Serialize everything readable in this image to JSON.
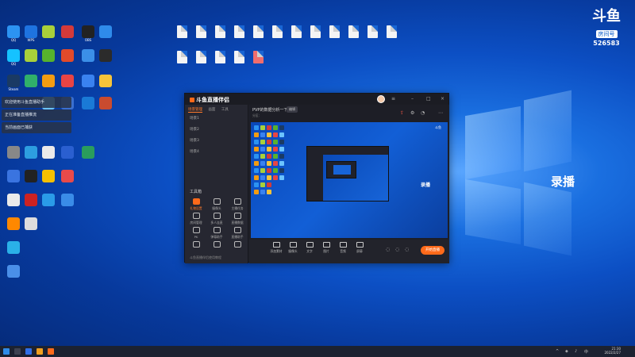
{
  "desktop_icons_left": [
    {
      "label": "QQ",
      "color": "#2c93f2"
    },
    {
      "label": "WPS",
      "color": "#1e73e0"
    },
    {
      "label": "",
      "color": "#a8d03a"
    },
    {
      "label": "",
      "color": "#d43a3a"
    },
    {
      "label": "OBS",
      "color": "#222222"
    },
    {
      "label": "",
      "color": "#2f8bea"
    },
    {
      "label": "QQ",
      "color": "#15c2ff"
    },
    {
      "label": "",
      "color": "#a8d03a"
    },
    {
      "label": "",
      "color": "#57b22d"
    },
    {
      "label": "",
      "color": "#e24a2a"
    },
    {
      "label": "",
      "color": "#3b8fe8"
    },
    {
      "label": "",
      "color": "#2b2b2b"
    },
    {
      "label": "Steam",
      "color": "#1a3a64"
    },
    {
      "label": "",
      "color": "#30b06a"
    },
    {
      "label": "",
      "color": "#f39c12"
    },
    {
      "label": "",
      "color": "#e94444"
    },
    {
      "label": "",
      "color": "#3a82f0"
    },
    {
      "label": "",
      "color": "#f6c43a"
    },
    {
      "label": "",
      "color": "#6cc3ff"
    },
    {
      "label": "",
      "color": "#3a6fd0"
    },
    {
      "label": "",
      "color": "#1a7ad6"
    },
    {
      "label": "",
      "color": "#c94b2f"
    },
    {
      "label": "",
      "color": "#888888"
    },
    {
      "label": "",
      "color": "#2d9ee0"
    },
    {
      "label": "",
      "color": "#eaeaea"
    },
    {
      "label": "",
      "color": "#2a5fd0"
    },
    {
      "label": "",
      "color": "#2a9d5c"
    },
    {
      "label": "",
      "color": "#3a74e0"
    },
    {
      "label": "",
      "color": "#222222"
    },
    {
      "label": "",
      "color": "#f5c000"
    },
    {
      "label": "",
      "color": "#e84a4a"
    },
    {
      "label": "",
      "color": "#eaeaea"
    },
    {
      "label": "",
      "color": "#cc2222"
    },
    {
      "label": "",
      "color": "#2a9be8"
    },
    {
      "label": "",
      "color": "#3a8ce8"
    },
    {
      "label": "",
      "color": "#ff8800"
    },
    {
      "label": "",
      "color": "#dddddd"
    },
    {
      "label": "",
      "color": "#2ab0e8"
    },
    {
      "label": "",
      "color": "#4a8fe8"
    }
  ],
  "desktop_files_top": [
    {
      "label": ""
    },
    {
      "label": ""
    },
    {
      "label": ""
    },
    {
      "label": ""
    },
    {
      "label": ""
    },
    {
      "label": ""
    },
    {
      "label": ""
    },
    {
      "label": ""
    },
    {
      "label": ""
    },
    {
      "label": ""
    },
    {
      "label": ""
    },
    {
      "label": ""
    },
    {
      "label": ""
    },
    {
      "label": ""
    },
    {
      "label": ""
    },
    {
      "label": ""
    },
    {
      "label": ""
    }
  ],
  "toasts": [
    "欢迎使用斗鱼直播助手",
    "正在准备直播推流",
    "当前画面已捕获"
  ],
  "douyu_logo": {
    "mark": "斗鱼",
    "pill": "房间号",
    "room_no": "526583"
  },
  "desktop_overlay_label": "录播",
  "app": {
    "logo_text": "斗鱼直播伴侣",
    "version_badge": "",
    "tabs": [
      "场景管理",
      "画面",
      "工具"
    ],
    "scenes": [
      "场景1",
      "场景2",
      "场景3",
      "场景4"
    ],
    "room_title": "PVP的数据分析一下",
    "room_tag": "编辑",
    "room_stats": [
      "分区：",
      "",
      ""
    ],
    "tools_title": "工具箱",
    "tools": [
      {
        "label": "礼物设置",
        "hot": true
      },
      {
        "label": "摄像头",
        "hot": false
      },
      {
        "label": "主播任务",
        "hot": false
      },
      {
        "label": "房间管理",
        "hot": false
      },
      {
        "label": "多人连麦",
        "hot": false
      },
      {
        "label": "直播数据",
        "hot": false
      },
      {
        "label": "PK",
        "hot": false
      },
      {
        "label": "弹幕助手",
        "hot": false
      },
      {
        "label": "直播助手",
        "hot": false
      },
      {
        "label": "",
        "hot": false
      },
      {
        "label": "",
        "hot": false
      },
      {
        "label": "",
        "hot": false
      }
    ],
    "bottom_hint": "斗鱼直播伴侣使用教程",
    "preview_label": "录播",
    "footer_buttons": [
      "添加素材",
      "摄像头",
      "文字",
      "图片",
      "音频",
      "屏幕"
    ],
    "start_label": "开始直播"
  },
  "taskbar": {
    "time": "21:30",
    "date": "2022/2/27"
  }
}
